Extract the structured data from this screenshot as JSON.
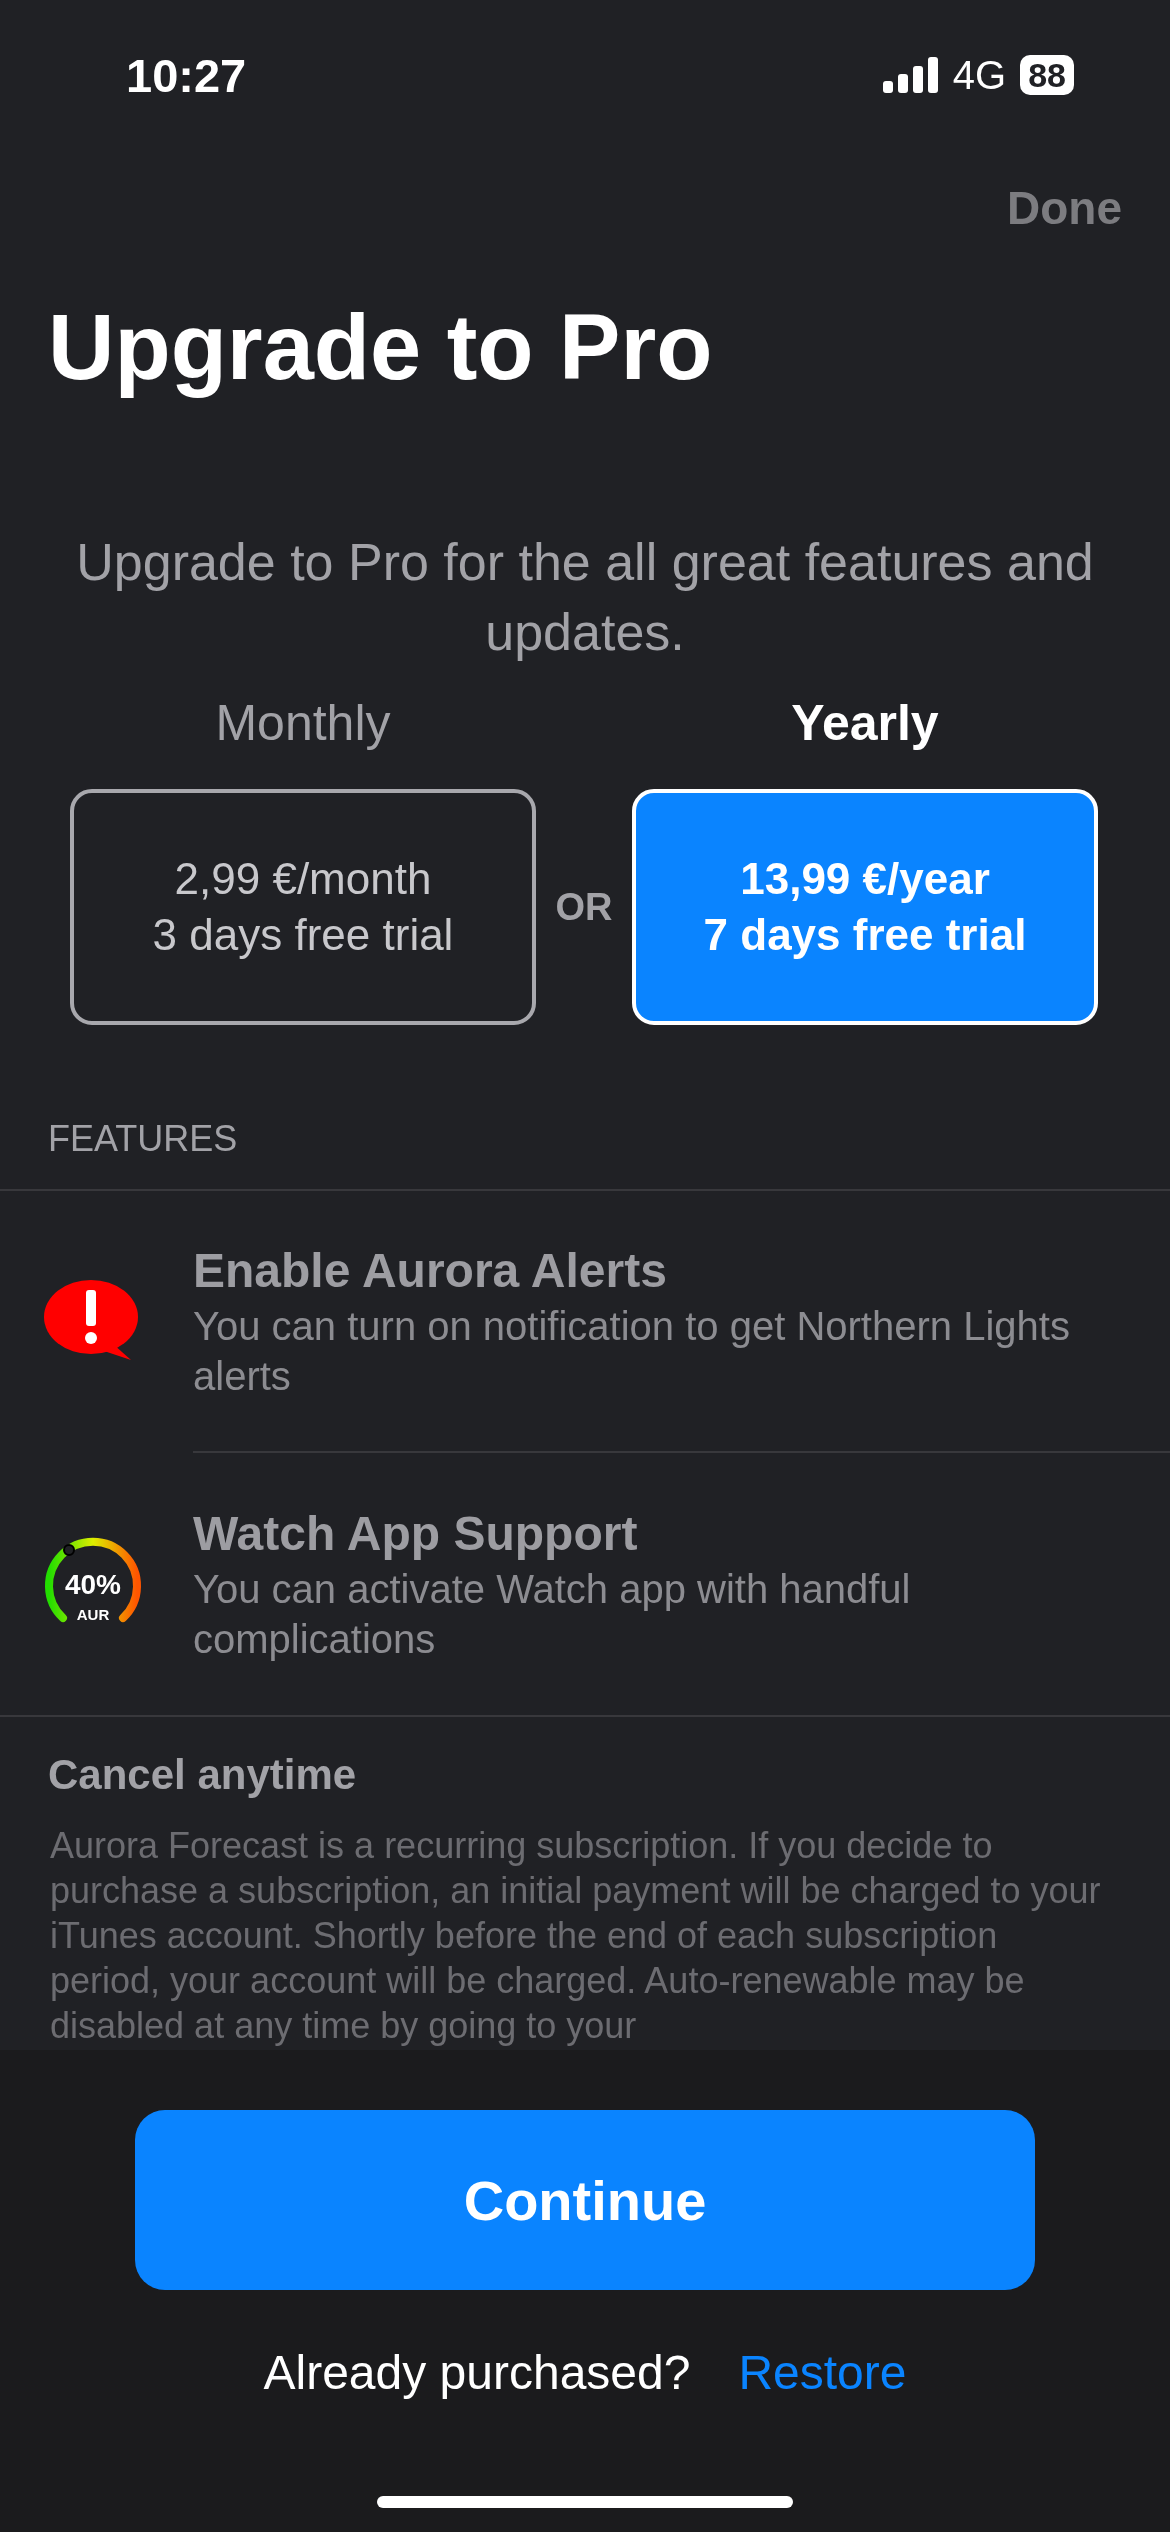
{
  "status_bar": {
    "time": "10:27",
    "network": "4G",
    "battery": "88"
  },
  "nav": {
    "done": "Done"
  },
  "title": "Upgrade to Pro",
  "subtitle": "Upgrade to Pro for the all great features and updates.",
  "plans": [
    {
      "label": "Monthly",
      "price": "2,99 €/month",
      "trial": "3 days free trial",
      "selected": false
    },
    {
      "label": "Yearly",
      "price": "13,99 €/year",
      "trial": "7 days free trial",
      "selected": true
    }
  ],
  "separator": "OR",
  "features_header": "FEATURES",
  "features": [
    {
      "kind": "alert",
      "title": "Enable Aurora Alerts",
      "description": "You can turn on notification to get Northern Lights alerts"
    },
    {
      "kind": "gauge",
      "title": "Watch App Support",
      "description": "You can activate Watch app with handful complications",
      "gauge_value": "40%",
      "gauge_unit": "AUR"
    }
  ],
  "terms": {
    "title": "Cancel anytime",
    "body": "Aurora Forecast is a recurring subscription. If you decide to purchase a subscription, an initial payment will be charged to your iTunes account. Shortly before the end of each subscription period, your account will be charged. Auto-renewable may be disabled at any time by going to your"
  },
  "continue_button": "Continue",
  "restore": {
    "prompt": "Already purchased?",
    "link": "Restore"
  }
}
